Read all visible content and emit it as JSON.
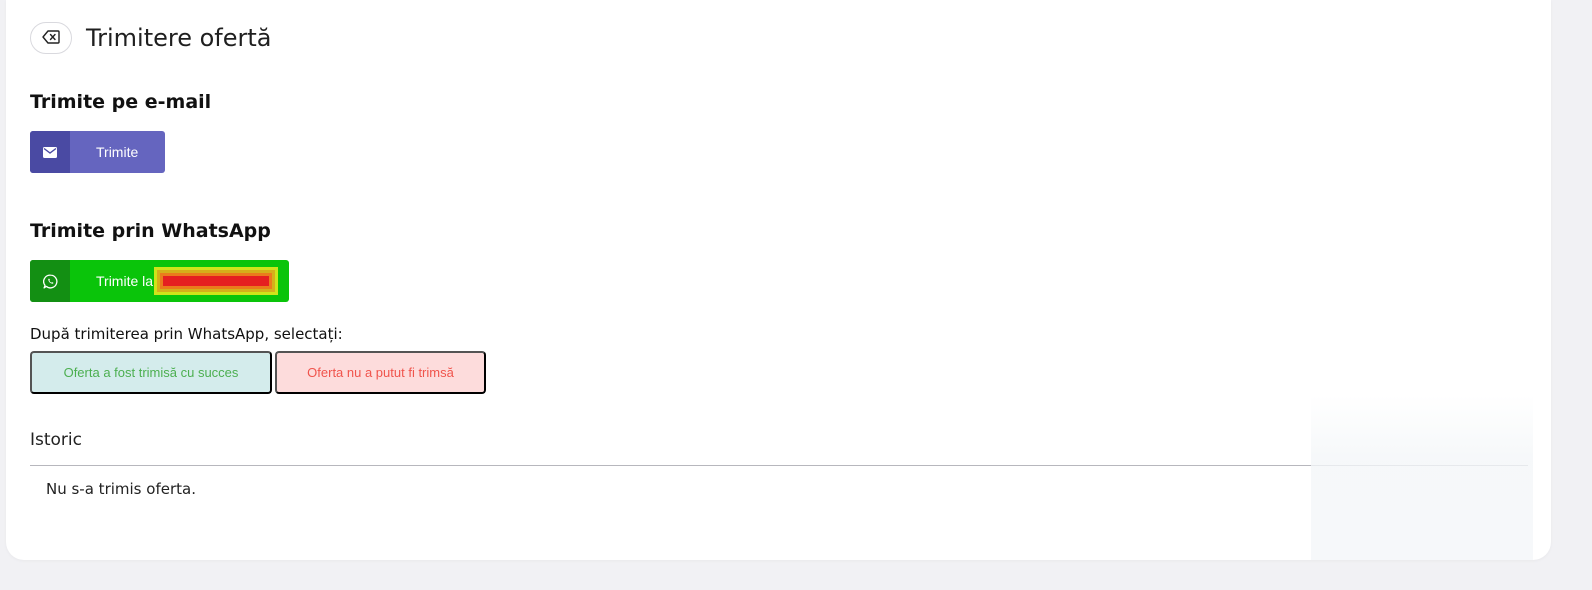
{
  "header": {
    "title": "Trimitere ofertă",
    "back_icon": "backspace-icon"
  },
  "email_section": {
    "title": "Trimite pe e-mail",
    "button_label": "Trimite",
    "icon": "envelope-icon",
    "accent": "#6565bf"
  },
  "whatsapp_section": {
    "title": "Trimite prin WhatsApp",
    "button_label": "Trimite la",
    "icon": "whatsapp-icon",
    "accent": "#0ac40a",
    "hint": "După trimiterea prin WhatsApp, selectați:",
    "success_label": "Oferta a fost trimisă cu succes",
    "fail_label": "Oferta nu a putut fi trimsă"
  },
  "history": {
    "title": "Istoric",
    "empty_text": "Nu s-a trimis oferta."
  }
}
